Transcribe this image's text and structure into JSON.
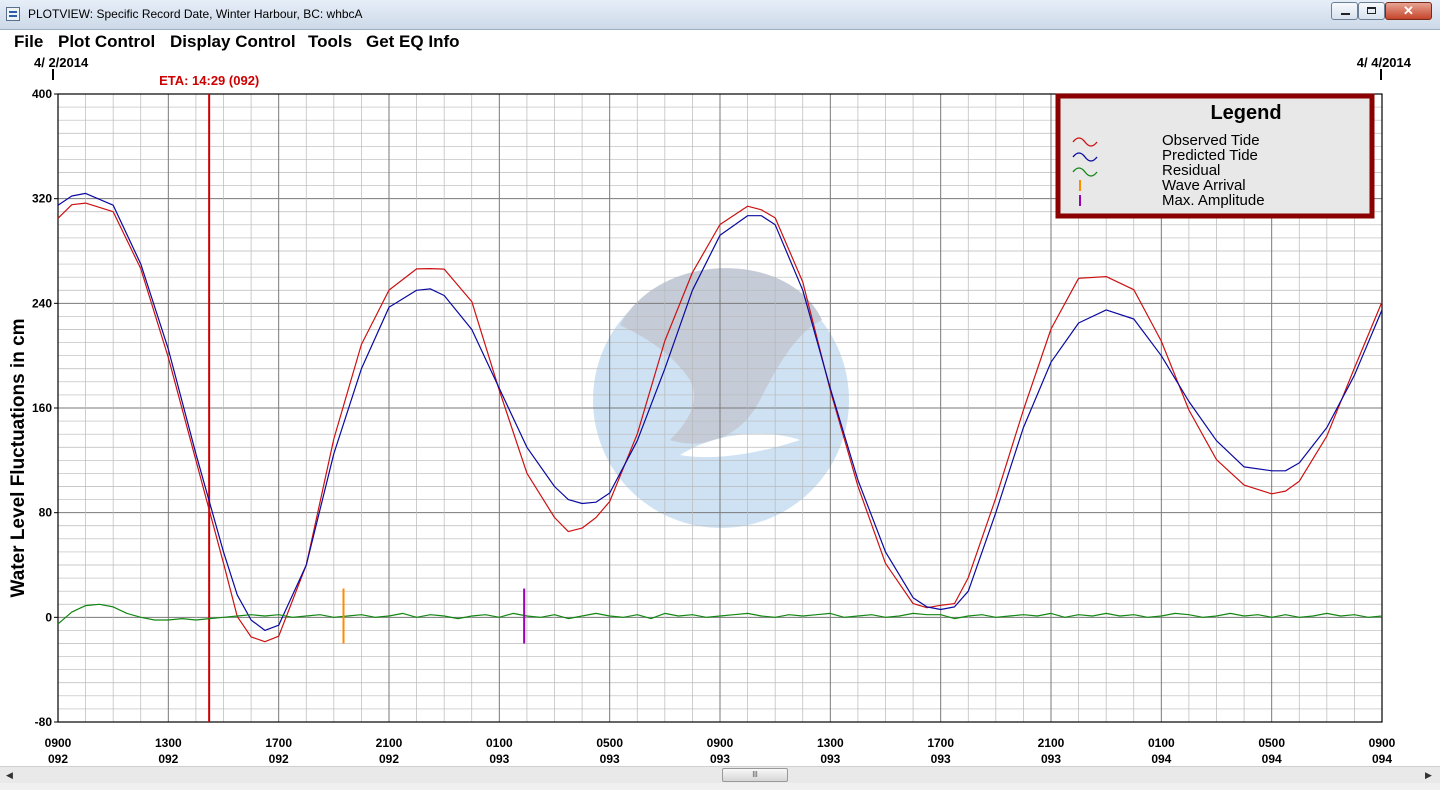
{
  "window": {
    "title": "PLOTVIEW: Specific Record Date, Winter Harbour, BC: whbcA",
    "minimize_label": "–",
    "maximize_label": "□",
    "close_label": "✕"
  },
  "menu": [
    "File",
    "Plot Control",
    "Display Control",
    "Tools",
    "Get EQ Info"
  ],
  "date_markers": {
    "start": "4/ 2/2014",
    "end": "4/ 4/2014"
  },
  "eta": {
    "label": "ETA: 14:29 (092)",
    "x_hour": 5.48,
    "color": "#cc0000"
  },
  "colors": {
    "observed": "#cc1111",
    "predicted": "#0a0aa0",
    "residual": "#128712",
    "wave_arrival": "#ff8c00",
    "max_amplitude": "#9b00b4",
    "legend_border": "#8b0000",
    "watermark": "#c7d2e4"
  },
  "legend": {
    "title": "Legend",
    "items": [
      {
        "label": "Observed Tide",
        "icon": "wave-icon",
        "color_key": "observed"
      },
      {
        "label": "Predicted Tide",
        "icon": "wave-icon",
        "color_key": "predicted"
      },
      {
        "label": "Residual",
        "icon": "wave-icon",
        "color_key": "residual"
      },
      {
        "label": "Wave Arrival",
        "icon": "tick-icon",
        "color_key": "wave_arrival"
      },
      {
        "label": "Max. Amplitude",
        "icon": "tick-icon",
        "color_key": "max_amplitude"
      }
    ]
  },
  "scrollbar": {
    "thumb_label": "lll",
    "left_arrow": "◀",
    "right_arrow": "▶"
  },
  "chart_data": {
    "type": "line",
    "title": "",
    "ylabel": "Water Level Fluctuations in cm",
    "xlabel": "",
    "ylim": [
      -80,
      400
    ],
    "yticks": [
      400,
      320,
      240,
      160,
      80,
      0,
      -80
    ],
    "xlim_hours": [
      0,
      48
    ],
    "x_ticks": [
      {
        "hour": 0,
        "time": "0900",
        "day": "092"
      },
      {
        "hour": 4,
        "time": "1300",
        "day": "092"
      },
      {
        "hour": 8,
        "time": "1700",
        "day": "092"
      },
      {
        "hour": 12,
        "time": "2100",
        "day": "092"
      },
      {
        "hour": 16,
        "time": "0100",
        "day": "093"
      },
      {
        "hour": 20,
        "time": "0500",
        "day": "093"
      },
      {
        "hour": 24,
        "time": "0900",
        "day": "093"
      },
      {
        "hour": 28,
        "time": "1300",
        "day": "093"
      },
      {
        "hour": 32,
        "time": "1700",
        "day": "093"
      },
      {
        "hour": 36,
        "time": "2100",
        "day": "093"
      },
      {
        "hour": 40,
        "time": "0100",
        "day": "094"
      },
      {
        "hour": 44,
        "time": "0500",
        "day": "094"
      },
      {
        "hour": 48,
        "time": "0900",
        "day": "094"
      }
    ],
    "grid": true,
    "legend_position": "top-right",
    "series": [
      {
        "name": "Observed Tide",
        "color_key": "observed",
        "x": [
          0,
          0.5,
          1,
          2,
          3,
          4,
          5,
          6,
          6.5,
          7,
          7.5,
          8,
          9,
          10,
          11,
          12,
          13,
          13.5,
          14,
          15,
          16,
          17,
          18,
          18.5,
          19,
          19.5,
          20,
          21,
          22,
          23,
          24,
          25,
          25.5,
          26,
          27,
          28,
          29,
          30,
          31,
          31.5,
          32,
          32.5,
          33,
          34,
          35,
          36,
          37,
          38,
          39,
          40,
          41,
          42,
          43,
          44,
          44.5,
          45,
          46,
          47,
          48
        ],
        "y": [
          305,
          314,
          318,
          310,
          265,
          200,
          120,
          40,
          2,
          -15,
          -20,
          -13,
          40,
          135,
          210,
          250,
          265,
          268,
          266,
          240,
          175,
          110,
          75,
          67,
          68,
          75,
          90,
          140,
          210,
          265,
          300,
          313,
          313,
          305,
          255,
          175,
          100,
          40,
          12,
          7,
          8,
          12,
          30,
          90,
          160,
          220,
          258,
          262,
          250,
          210,
          160,
          120,
          100,
          96,
          96,
          103,
          140,
          190,
          240
        ]
      },
      {
        "name": "Predicted Tide",
        "color_key": "predicted",
        "x": [
          0,
          0.5,
          1,
          2,
          3,
          4,
          5,
          6,
          6.5,
          7,
          7.5,
          8,
          9,
          10,
          11,
          12,
          13,
          13.5,
          14,
          15,
          16,
          17,
          18,
          18.5,
          19,
          19.5,
          20,
          21,
          22,
          23,
          24,
          25,
          25.5,
          26,
          27,
          28,
          29,
          30,
          31,
          31.5,
          32,
          32.5,
          33,
          34,
          35,
          36,
          37,
          38,
          39,
          40,
          41,
          42,
          43,
          44,
          44.5,
          45,
          46,
          47,
          48
        ],
        "y": [
          315,
          322,
          324,
          315,
          270,
          205,
          125,
          50,
          17,
          -2,
          -10,
          -6,
          40,
          125,
          190,
          237,
          250,
          251,
          246,
          220,
          175,
          130,
          100,
          90,
          87,
          88,
          95,
          135,
          190,
          250,
          292,
          307,
          307,
          300,
          250,
          175,
          105,
          50,
          15,
          8,
          6,
          8,
          20,
          80,
          145,
          195,
          225,
          235,
          228,
          200,
          165,
          135,
          115,
          112,
          112,
          118,
          145,
          185,
          235
        ]
      },
      {
        "name": "Residual",
        "color_key": "residual",
        "x": [
          0,
          0.5,
          1,
          1.5,
          2,
          2.5,
          3,
          3.5,
          4,
          4.5,
          5,
          5.5,
          6,
          6.5,
          7,
          7.5,
          8,
          8.5,
          9,
          9.5,
          10,
          10.5,
          11,
          11.5,
          12,
          12.5,
          13,
          13.5,
          14,
          14.5,
          15,
          15.5,
          16,
          16.5,
          17,
          17.5,
          18,
          18.5,
          19,
          19.5,
          20,
          20.5,
          21,
          21.5,
          22,
          22.5,
          23,
          23.5,
          24,
          24.5,
          25,
          25.5,
          26,
          26.5,
          27,
          27.5,
          28,
          28.5,
          29,
          29.5,
          30,
          30.5,
          31,
          31.5,
          32,
          32.5,
          33,
          33.5,
          34,
          34.5,
          35,
          35.5,
          36,
          36.5,
          37,
          37.5,
          38,
          38.5,
          39,
          39.5,
          40,
          40.5,
          41,
          41.5,
          42,
          42.5,
          43,
          43.5,
          44,
          44.5,
          45,
          45.5,
          46,
          46.5,
          47,
          47.5,
          48
        ],
        "y": [
          -5,
          4,
          9,
          10,
          8,
          3,
          0,
          -2,
          -2,
          -1,
          -2,
          -1,
          0,
          1,
          2,
          1,
          2,
          0,
          1,
          2,
          0,
          1,
          2,
          0,
          1,
          3,
          0,
          2,
          1,
          -1,
          1,
          2,
          0,
          3,
          1,
          0,
          2,
          -1,
          1,
          3,
          1,
          0,
          2,
          -1,
          3,
          1,
          2,
          0,
          1,
          2,
          3,
          1,
          0,
          2,
          1,
          2,
          3,
          0,
          1,
          2,
          0,
          1,
          3,
          2,
          2,
          -1,
          1,
          2,
          0,
          1,
          2,
          1,
          3,
          0,
          2,
          1,
          3,
          1,
          2,
          0,
          1,
          3,
          2,
          0,
          1,
          3,
          1,
          2,
          0,
          2,
          0,
          1,
          3,
          1,
          2,
          0,
          1
        ]
      }
    ],
    "events": [
      {
        "name": "Wave Arrival",
        "x_hour": 10.35,
        "y_range": [
          -20,
          22
        ],
        "color_key": "wave_arrival"
      },
      {
        "name": "Max. Amplitude",
        "x_hour": 16.9,
        "y_range": [
          -20,
          22
        ],
        "color_key": "max_amplitude"
      }
    ]
  }
}
